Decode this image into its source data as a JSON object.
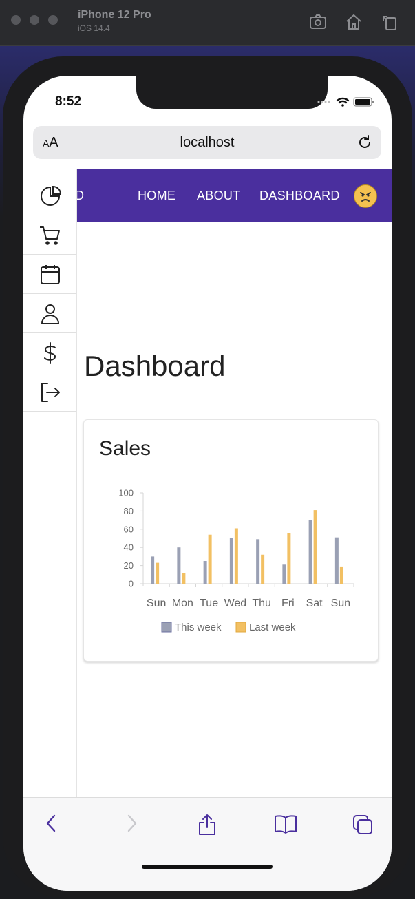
{
  "simulator": {
    "device_name": "iPhone 12 Pro",
    "os_version": "iOS 14.4",
    "icons": [
      "screenshot-icon",
      "home-icon",
      "rotate-icon"
    ]
  },
  "status_bar": {
    "time": "8:52"
  },
  "browser": {
    "text_size_label": "AA",
    "url": "localhost"
  },
  "navbar": {
    "color": "#4a2f9e",
    "partial_brand": "D",
    "links": [
      "HOME",
      "ABOUT",
      "DASHBOARD"
    ]
  },
  "sidebar": {
    "items": [
      "pie-chart-icon",
      "cart-icon",
      "calendar-icon",
      "user-icon",
      "dollar-icon",
      "logout-icon"
    ]
  },
  "page": {
    "title": "Dashboard"
  },
  "card": {
    "title": "Sales"
  },
  "chart_data": {
    "type": "bar",
    "categories": [
      "Sun",
      "Mon",
      "Tue",
      "Wed",
      "Thu",
      "Fri",
      "Sat",
      "Sun"
    ],
    "series": [
      {
        "name": "This week",
        "color": "#9aa0b4",
        "values": [
          30,
          40,
          25,
          50,
          49,
          21,
          70,
          51
        ]
      },
      {
        "name": "Last week",
        "color": "#f2c063",
        "values": [
          23,
          12,
          54,
          61,
          32,
          56,
          81,
          19
        ]
      }
    ],
    "yticks": [
      "100",
      "80",
      "60",
      "40",
      "20",
      "0"
    ],
    "ylim": [
      0,
      100
    ],
    "legend_position": "bottom"
  },
  "toolbar": {
    "icons": [
      "back-icon",
      "forward-icon",
      "share-icon",
      "bookmarks-icon",
      "tabs-icon"
    ]
  }
}
